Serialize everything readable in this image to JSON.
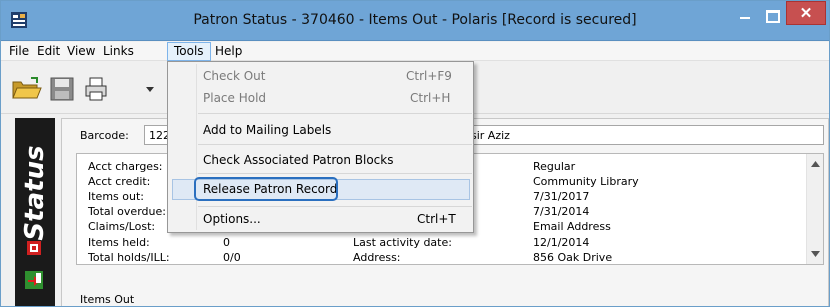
{
  "window": {
    "title": "Patron Status - 370460 - Items Out - Polaris [Record is secured]",
    "close_glyph": "✕"
  },
  "menubar": {
    "items": [
      "File",
      "Edit",
      "View",
      "Links",
      "Tools",
      "Help"
    ],
    "active": "Tools"
  },
  "tools_menu": {
    "items": [
      {
        "label": "Check Out",
        "shortcut": "Ctrl+F9",
        "enabled": false
      },
      {
        "label": "Place Hold",
        "shortcut": "Ctrl+H",
        "enabled": false
      },
      {
        "label": "Add to Mailing Labels",
        "shortcut": "",
        "enabled": true
      },
      {
        "label": "Check Associated Patron Blocks",
        "shortcut": "",
        "enabled": true
      },
      {
        "label": "Release Patron Record",
        "shortcut": "",
        "enabled": true,
        "highlighted": true
      },
      {
        "label": "Options...",
        "shortcut": "Ctrl+T",
        "enabled": true
      }
    ]
  },
  "status_strip": {
    "label": "Status"
  },
  "patron": {
    "barcode_label": "Barcode:",
    "barcode_value": "122",
    "name_value": "sir Aziz",
    "left_labels": [
      "Acct charges:",
      "Acct credit:",
      "Items out:",
      "Total overdue:",
      "Claims/Lost:",
      "Items held:",
      "Total holds/ILL:"
    ],
    "left_values": [
      "",
      "",
      "",
      "",
      "",
      "0",
      "0/0"
    ],
    "right_labels": [
      "",
      "",
      "",
      "",
      "",
      "Last activity date:",
      "Address:"
    ],
    "right_values": [
      "Regular",
      "Community Library",
      "7/31/2017",
      "7/31/2014",
      "Email Address",
      "12/1/2014",
      "856 Oak Drive"
    ]
  },
  "bottom": {
    "items_out_label": "Items Out"
  },
  "colors": {
    "titlebar": "#6fa5d6",
    "close_button": "#c75050",
    "status_strip": "#1a1a1a",
    "focus_ring": "#2a6fbf"
  }
}
